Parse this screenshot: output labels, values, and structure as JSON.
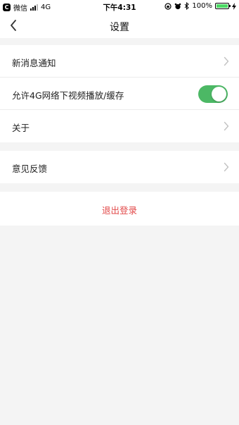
{
  "status_bar": {
    "carrier": "微信",
    "network": "4G",
    "time": "下午4:31",
    "battery": "100%",
    "battery_level": 1.0
  },
  "nav": {
    "title": "设置",
    "back_icon": "chevron-left-icon"
  },
  "settings": {
    "new_message_notify": "新消息通知",
    "allow_4g_video": "允许4G网络下视频播放/缓存",
    "allow_4g_video_enabled": true,
    "about": "关于",
    "feedback": "意见反馈"
  },
  "logout": {
    "label": "退出登录",
    "color": "#e24a4a"
  },
  "colors": {
    "toggle_on": "#4cb865",
    "background": "#f4f4f4"
  }
}
